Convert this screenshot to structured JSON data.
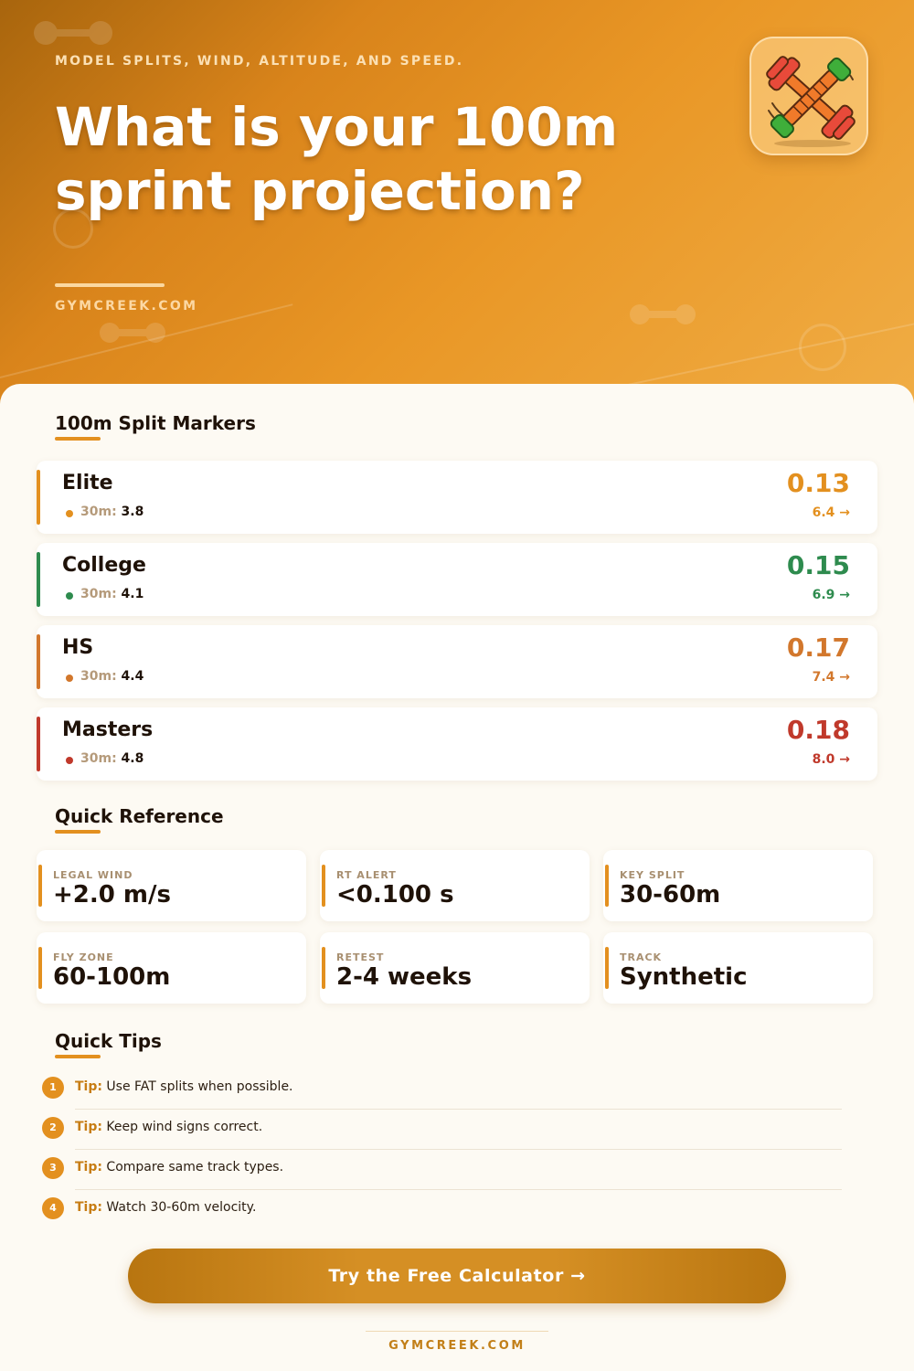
{
  "hero": {
    "tagline": "MODEL SPLITS, WIND, ALTITUDE, AND SPEED.",
    "title": "What is your 100m sprint projection?",
    "site": "GYMCREEK.COM",
    "app_icon": "crossed-dumbbells-icon"
  },
  "splits": {
    "title": "100m Split Markers",
    "items": [
      {
        "level": "Elite",
        "label30": "30m:",
        "val30": "3.8",
        "reaction": "0.13",
        "sixty": "6.4 →",
        "color": "#e3901f"
      },
      {
        "level": "College",
        "label30": "30m:",
        "val30": "4.1",
        "reaction": "0.15",
        "sixty": "6.9 →",
        "color": "#2e8b4e"
      },
      {
        "level": "HS",
        "label30": "30m:",
        "val30": "4.4",
        "reaction": "0.17",
        "sixty": "7.4 →",
        "color": "#d2772c"
      },
      {
        "level": "Masters",
        "label30": "30m:",
        "val30": "4.8",
        "reaction": "0.18",
        "sixty": "8.0 →",
        "color": "#c0392b"
      }
    ]
  },
  "reference": {
    "title": "Quick Reference",
    "items": [
      {
        "label": "LEGAL WIND",
        "value": "+2.0 m/s"
      },
      {
        "label": "RT ALERT",
        "value": "<0.100 s"
      },
      {
        "label": "KEY SPLIT",
        "value": "30-60m"
      },
      {
        "label": "FLY ZONE",
        "value": "60-100m"
      },
      {
        "label": "RETEST",
        "value": "2-4 weeks"
      },
      {
        "label": "TRACK",
        "value": "Synthetic"
      }
    ]
  },
  "tips": {
    "title": "Quick Tips",
    "prefix": "Tip:",
    "items": [
      {
        "num": "1",
        "text": "Use FAT splits when possible."
      },
      {
        "num": "2",
        "text": "Keep wind signs correct."
      },
      {
        "num": "3",
        "text": "Compare same track types."
      },
      {
        "num": "4",
        "text": "Watch 30-60m velocity."
      }
    ]
  },
  "cta": {
    "label": "Try the Free Calculator →"
  },
  "footer": {
    "site": "GYMCREEK.COM"
  },
  "colors": {
    "accent": "#e3901f",
    "brand_dark": "#c27f18"
  }
}
